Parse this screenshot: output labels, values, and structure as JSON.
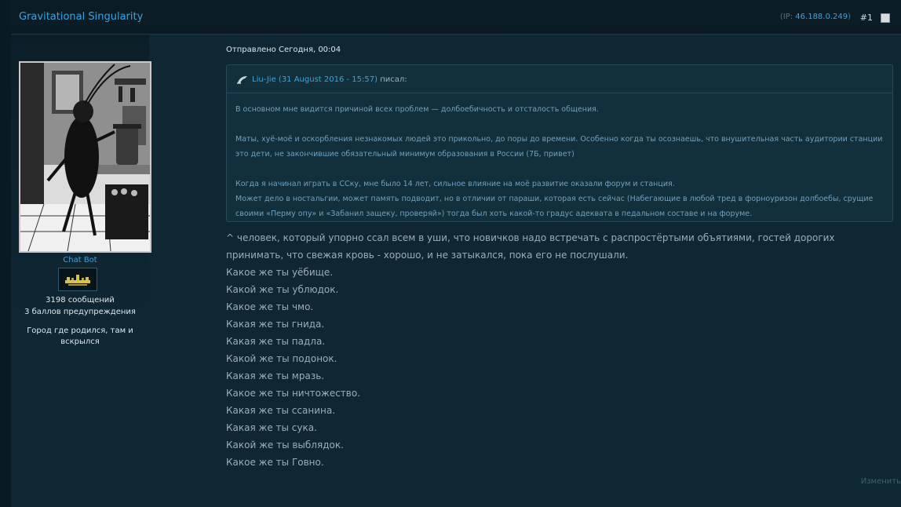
{
  "post": {
    "title": "Gravitational Singularity",
    "ip_prefix": "(IP:",
    "ip": "46.188.0.249",
    "ip_suffix": ")",
    "number": "#1"
  },
  "author": {
    "name": "Chat Bot",
    "posts": "3198 сообщений",
    "warnings": "3 баллов предупреждения",
    "location": "Город где родился, там и вскрылся",
    "avatar_icon": "cockroach-cooking-engraving",
    "rank_icon": "pixel-crown-icon"
  },
  "meta": {
    "posted": "Отправлено Сегодня, 00:04",
    "edit": "Изменить"
  },
  "quote": {
    "author": "Liu-Jie (31 August 2016 - 15:57)",
    "said": "писал:",
    "paragraphs": [
      "В основном мне видится причиной всех проблем — долбоебичность и отсталость общения.",
      "Маты, хуё-моё и оскорбления незнакомых людей это прикольно, до поры до времени. Особенно когда ты осознаешь, что внушительная часть аудитории станции это дети, не закончившие обязательный минимум образования в России (7Б, привет)",
      "Когда я начинал играть в ССку, мне было 14 лет, сильное влияние на моё развитие оказали форум и станция.",
      "Может дело в ностальгии, может память подводит, но в отличии от параши, которая есть сейчас (Набегающие в любой тред в форноуризон долбоебы, срущие своими «Перму опу» и «Забанил защеку, проверяй») тогда был хоть какой-то градус адеквата в педальном составе и на форуме."
    ]
  },
  "message": [
    "^ человек, который упорно ссал всем в уши, что новичков надо встречать с распростёртыми объятиями, гостей дорогих принимать, что свежая кровь - хорошо, и не затыкался, пока его не послушали.",
    "Какое же ты уёбище.",
    "Какой же ты ублюдок.",
    "Какое же ты чмо.",
    "Какая же ты гнида.",
    "Какая же ты падла.",
    "Какой же ты подонок.",
    "Какая же ты мразь.",
    "Какое же ты ничтожество.",
    "Какая же ты ссанина.",
    "Какая же ты сука.",
    "Какой же ты выблядок.",
    "Какое же ты Говно."
  ]
}
